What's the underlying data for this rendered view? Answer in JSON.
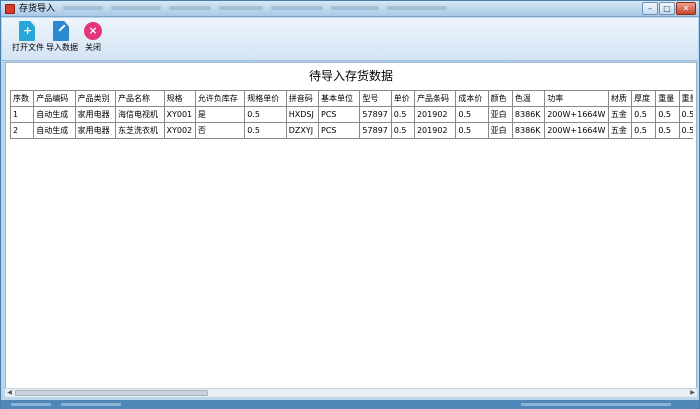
{
  "window": {
    "title": "存货导入"
  },
  "toolbar": {
    "open_label": "打开文件",
    "import_label": "导入数据",
    "close_label": "关闭"
  },
  "main": {
    "heading": "待导入存货数据"
  },
  "table": {
    "columns": [
      "序数",
      "产品编码",
      "产品类别",
      "产品名称",
      "规格",
      "允许负库存",
      "规格单价",
      "拼音码",
      "基本单位",
      "型号",
      "单价",
      "产品条码",
      "成本价",
      "颜色",
      "色温",
      "功率",
      "材质",
      "厚度",
      "重量",
      "重量单"
    ],
    "rows": [
      [
        "1",
        "自动生成",
        "家用电器",
        "海信电视机",
        "XY001",
        "是",
        "0.5",
        "HXDSJ",
        "PCS",
        "57897",
        "0.5",
        "201902",
        "0.5",
        "亚白",
        "8386K",
        "200W+1664W",
        "五金",
        "0.5",
        "0.5",
        "0.5"
      ],
      [
        "2",
        "自动生成",
        "家用电器",
        "东芝洗衣机",
        "XY002",
        "否",
        "0.5",
        "DZXYJ",
        "PCS",
        "57897",
        "0.5",
        "201902",
        "0.5",
        "亚白",
        "8386K",
        "200W+1664W",
        "五金",
        "0.5",
        "0.5",
        "0.5"
      ]
    ]
  },
  "colors": {
    "titlebar": "#a9c8e6",
    "toolbar": "#e3eef9",
    "close_icon": "#e2357a",
    "open_icon": "#29a6d8"
  }
}
